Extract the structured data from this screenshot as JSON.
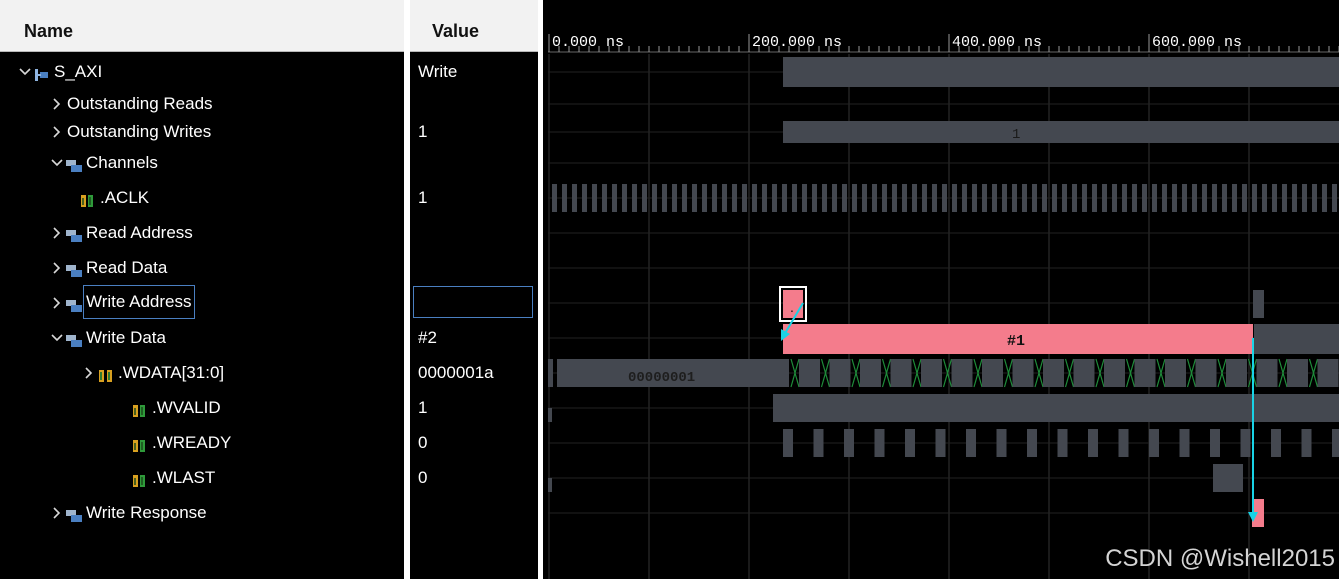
{
  "header": {
    "name_label": "Name",
    "value_label": "Value"
  },
  "tree": [
    {
      "id": "s_axi",
      "label": "S_AXI",
      "value": "Write",
      "indent": 0,
      "expander": "expanded",
      "icon": "interface-icon"
    },
    {
      "id": "outstanding-reads",
      "label": "Outstanding Reads",
      "value": "",
      "indent": 1,
      "expander": "collapsed",
      "icon": ""
    },
    {
      "id": "outstanding-writes",
      "label": "Outstanding Writes",
      "value": "1",
      "indent": 1,
      "expander": "collapsed",
      "icon": ""
    },
    {
      "id": "channels",
      "label": "Channels",
      "value": "",
      "indent": 1,
      "expander": "expanded",
      "icon": "group-icon"
    },
    {
      "id": "aclk",
      "label": ".ACLK",
      "value": "1",
      "indent": 3,
      "expander": "",
      "icon": "signal-icon"
    },
    {
      "id": "read-address",
      "label": "Read Address",
      "value": "",
      "indent": 2,
      "expander": "collapsed",
      "icon": "group-icon"
    },
    {
      "id": "read-data",
      "label": "Read Data",
      "value": "",
      "indent": 2,
      "expander": "collapsed",
      "icon": "group-icon"
    },
    {
      "id": "write-address",
      "label": "Write Address",
      "value": "",
      "indent": 2,
      "expander": "collapsed",
      "icon": "group-icon"
    },
    {
      "id": "write-data",
      "label": "Write Data",
      "value": "#2",
      "indent": 2,
      "expander": "expanded",
      "icon": "group-icon"
    },
    {
      "id": "wdata",
      "label": ".WDATA[31:0]",
      "value": "0000001a",
      "indent": 3,
      "expander": "collapsed",
      "icon": "bus-icon"
    },
    {
      "id": "wvalid",
      "label": ".WVALID",
      "value": "1",
      "indent": 4,
      "expander": "",
      "icon": "signal-icon"
    },
    {
      "id": "wready",
      "label": ".WREADY",
      "value": "0",
      "indent": 4,
      "expander": "",
      "icon": "signal-icon"
    },
    {
      "id": "wlast",
      "label": ".WLAST",
      "value": "0",
      "indent": 4,
      "expander": "",
      "icon": "signal-icon"
    },
    {
      "id": "write-response",
      "label": "Write Response",
      "value": "",
      "indent": 2,
      "expander": "collapsed",
      "icon": "group-icon"
    }
  ],
  "timeline": {
    "time_labels": [
      "0.000 ns",
      "200.000 ns",
      "400.000 ns",
      "600.000 ns"
    ],
    "outstanding_writes_label": "1",
    "write_data_transaction_label": "#1",
    "wdata_initial_value": "00000001",
    "write_address_marker_label": "."
  },
  "colors": {
    "background": "#000000",
    "header_bg": "#f2f2f2",
    "bus_gray": "#444850",
    "transaction_pink": "#f47c8c",
    "arrow_cyan": "#19d3e6",
    "grid_line": "#333333",
    "selection_border": "#4a7fc1",
    "toggle_green": "#1e8c3a"
  },
  "watermark": "CSDN @Wishell2015"
}
